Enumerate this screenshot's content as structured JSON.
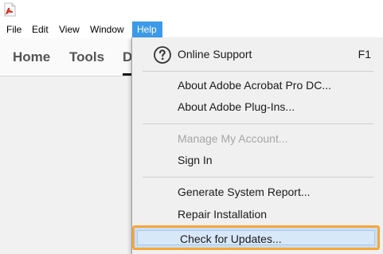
{
  "app": {
    "icon": "acrobat-pdf-icon"
  },
  "menubar": {
    "items": [
      "File",
      "Edit",
      "View",
      "Window",
      "Help"
    ],
    "active": "Help"
  },
  "toolbar": {
    "tabs": [
      "Home",
      "Tools",
      "D"
    ]
  },
  "help_menu": {
    "online_support": {
      "label": "Online Support",
      "shortcut": "F1",
      "icon": "question-circle-icon"
    },
    "about_acrobat": "About Adobe Acrobat Pro DC...",
    "about_plugins": "About Adobe Plug-Ins...",
    "manage_account": "Manage My Account...",
    "sign_in": "Sign In",
    "generate_report": "Generate System Report...",
    "repair_installation": "Repair Installation",
    "check_updates": "Check for Updates..."
  },
  "colors": {
    "menu_highlight": "#3d9ae8",
    "annotation_outline": "#f5a73a",
    "acrobat_red": "#e02a1f"
  }
}
